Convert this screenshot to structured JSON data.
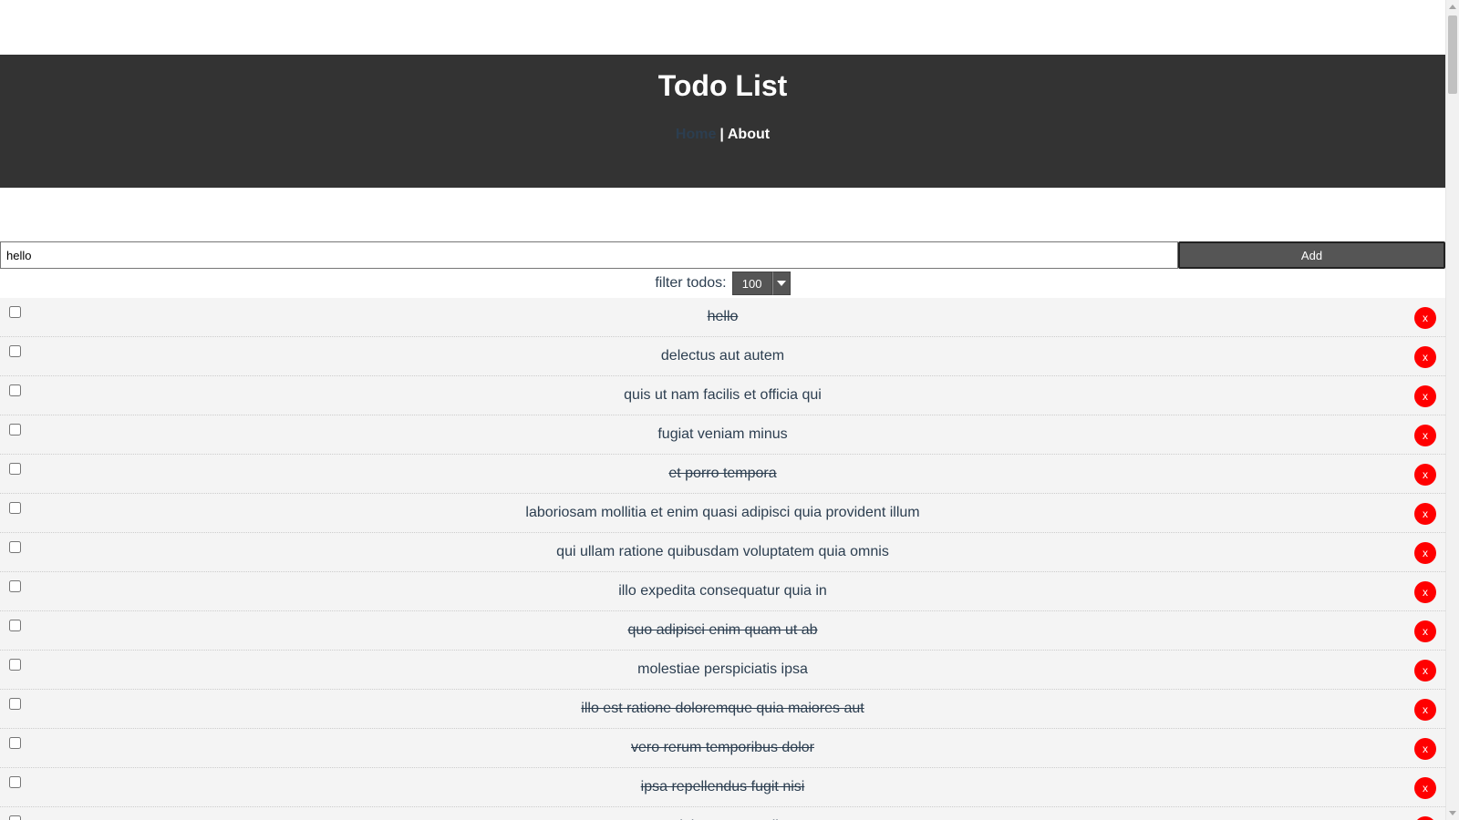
{
  "header": {
    "title": "Todo List",
    "nav": {
      "home": "Home",
      "separator": "|",
      "about": "About"
    }
  },
  "form": {
    "input_value": "hello",
    "add_label": "Add"
  },
  "filter": {
    "label": "filter todos:",
    "selected": "100"
  },
  "todos": [
    {
      "title": "hello",
      "completed": true
    },
    {
      "title": "delectus aut autem",
      "completed": false
    },
    {
      "title": "quis ut nam facilis et officia qui",
      "completed": false
    },
    {
      "title": "fugiat veniam minus",
      "completed": false
    },
    {
      "title": "et porro tempora",
      "completed": true
    },
    {
      "title": "laboriosam mollitia et enim quasi adipisci quia provident illum",
      "completed": false
    },
    {
      "title": "qui ullam ratione quibusdam voluptatem quia omnis",
      "completed": false
    },
    {
      "title": "illo expedita consequatur quia in",
      "completed": false
    },
    {
      "title": "quo adipisci enim quam ut ab",
      "completed": true
    },
    {
      "title": "molestiae perspiciatis ipsa",
      "completed": false
    },
    {
      "title": "illo est ratione doloremque quia maiores aut",
      "completed": true
    },
    {
      "title": "vero rerum temporibus dolor",
      "completed": true
    },
    {
      "title": "ipsa repellendus fugit nisi",
      "completed": true
    },
    {
      "title": "et doloremque nulla",
      "completed": false
    }
  ],
  "delete_label": "x",
  "colors": {
    "header_bg": "#333333",
    "delete_button": "#ff0000",
    "add_button": "#555555",
    "text": "#2c3e50",
    "item_bg": "#f4f4f4"
  }
}
